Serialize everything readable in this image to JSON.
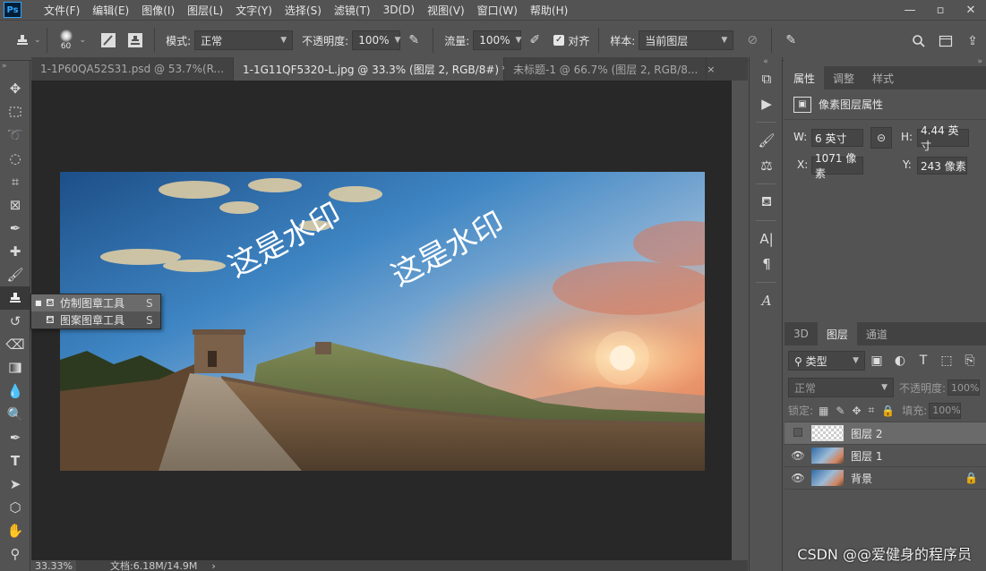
{
  "app": {
    "logo": "Ps"
  },
  "menu": [
    "文件(F)",
    "编辑(E)",
    "图像(I)",
    "图层(L)",
    "文字(Y)",
    "选择(S)",
    "滤镜(T)",
    "3D(D)",
    "视图(V)",
    "窗口(W)",
    "帮助(H)"
  ],
  "options": {
    "brush_size": "60",
    "mode_label": "模式:",
    "mode_value": "正常",
    "opacity_label": "不透明度:",
    "opacity_value": "100%",
    "flow_label": "流量:",
    "flow_value": "100%",
    "aligned_label": "对齐",
    "sample_label": "样本:",
    "sample_value": "当前图层"
  },
  "tabs": [
    {
      "label": "1-1P60QA52S31.psd @ 53.7%(R...",
      "close": "×"
    },
    {
      "label": "1-1G11QF5320-L.jpg @ 33.3% (图层 2, RGB/8#) *",
      "close": "×"
    },
    {
      "label": "未标题-1 @ 66.7% (图层 2, RGB/8...",
      "close": "×"
    }
  ],
  "flyout": {
    "items": [
      {
        "label": "仿制图章工具",
        "key": "S"
      },
      {
        "label": "图案图章工具",
        "key": "S"
      }
    ]
  },
  "image": {
    "watermarks": [
      "这是水印",
      "这是水印"
    ]
  },
  "status": {
    "zoom": "33.33%",
    "doc": "文档:6.18M/14.9M"
  },
  "properties": {
    "tabs": [
      "属性",
      "调整",
      "样式"
    ],
    "title": "像素图层属性",
    "w_label": "W:",
    "w_value": "6 英寸",
    "h_label": "H:",
    "h_value": "4.44 英寸",
    "x_label": "X:",
    "x_value": "1071 像素",
    "y_label": "Y:",
    "y_value": "243 像素"
  },
  "layers": {
    "tabs": [
      "3D",
      "图层",
      "通道"
    ],
    "filter_label": "类型",
    "blend_mode": "正常",
    "opacity_label": "不透明度:",
    "opacity_value": "100%",
    "lock_label": "锁定:",
    "fill_label": "填充:",
    "fill_value": "100%",
    "items": [
      {
        "name": "图层 2"
      },
      {
        "name": "图层 1"
      },
      {
        "name": "背景"
      }
    ]
  },
  "overlay_text": "CSDN @@爱健身的程序员"
}
